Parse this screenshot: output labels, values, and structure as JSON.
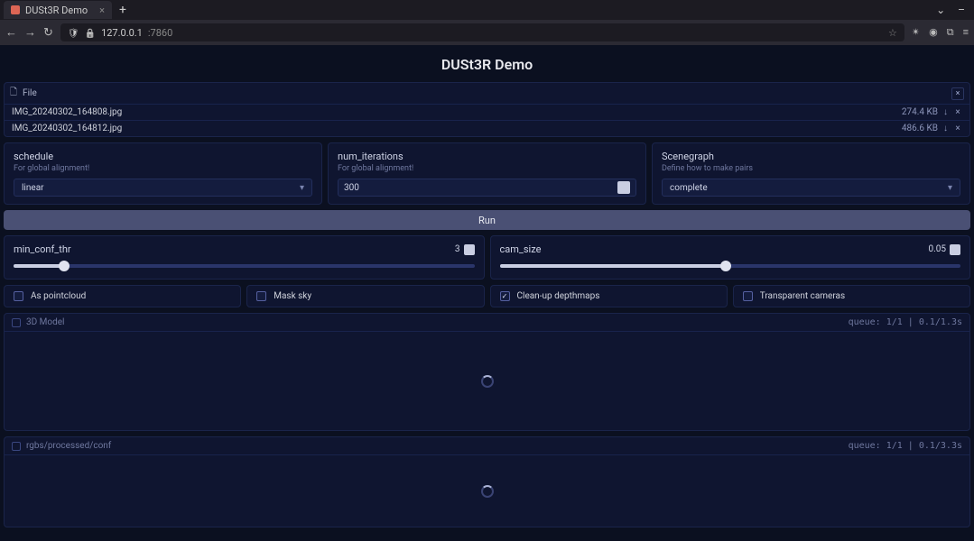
{
  "browser": {
    "tab_title": "DUSt3R Demo",
    "newtab_glyph": "+",
    "winctrl": {
      "chevron": "⌄",
      "min": "–",
      "close": ""
    },
    "nav": {
      "back": "←",
      "fwd": "→",
      "reload": "↻"
    },
    "url": {
      "host": "127.0.0.1",
      "rest": ":7860"
    },
    "ext": {
      "star": "☆",
      "shield": "✴",
      "user": "◉",
      "box": "⧉",
      "menu": "≡"
    }
  },
  "app": {
    "title": "DUSt3R Demo",
    "file": {
      "dropzone": "File",
      "clear_x": "×",
      "items": [
        {
          "name": "IMG_20240302_164808.jpg",
          "size": "274.4 KB",
          "dl": "↓",
          "rm": "×"
        },
        {
          "name": "IMG_20240302_164812.jpg",
          "size": "486.6 KB",
          "dl": "↓",
          "rm": "×"
        }
      ]
    },
    "schedule": {
      "label": "schedule",
      "sub": "For global alignment!",
      "value": "linear"
    },
    "iters": {
      "label": "num_iterations",
      "sub": "For global alignment!",
      "value": "300"
    },
    "scenegraph": {
      "label": "Scenegraph",
      "sub": "Define how to make pairs",
      "value": "complete"
    },
    "run_label": "Run",
    "minconf": {
      "label": "min_conf_thr",
      "value": "3",
      "fill_pct": 11
    },
    "camsize": {
      "label": "cam_size",
      "value": "0.05",
      "fill_pct": 49
    },
    "checks": {
      "pointcloud": "As pointcloud",
      "masksky": "Mask sky",
      "cleanup": "Clean-up depthmaps",
      "transcam": "Transparent cameras"
    },
    "viewer3d": {
      "label": "3D Model",
      "queue": "queue: 1/1 | 0.1/1.3s"
    },
    "viewerRGB": {
      "label": "rgbs/processed/conf",
      "queue": "queue: 1/1 | 0.1/3.3s"
    }
  }
}
